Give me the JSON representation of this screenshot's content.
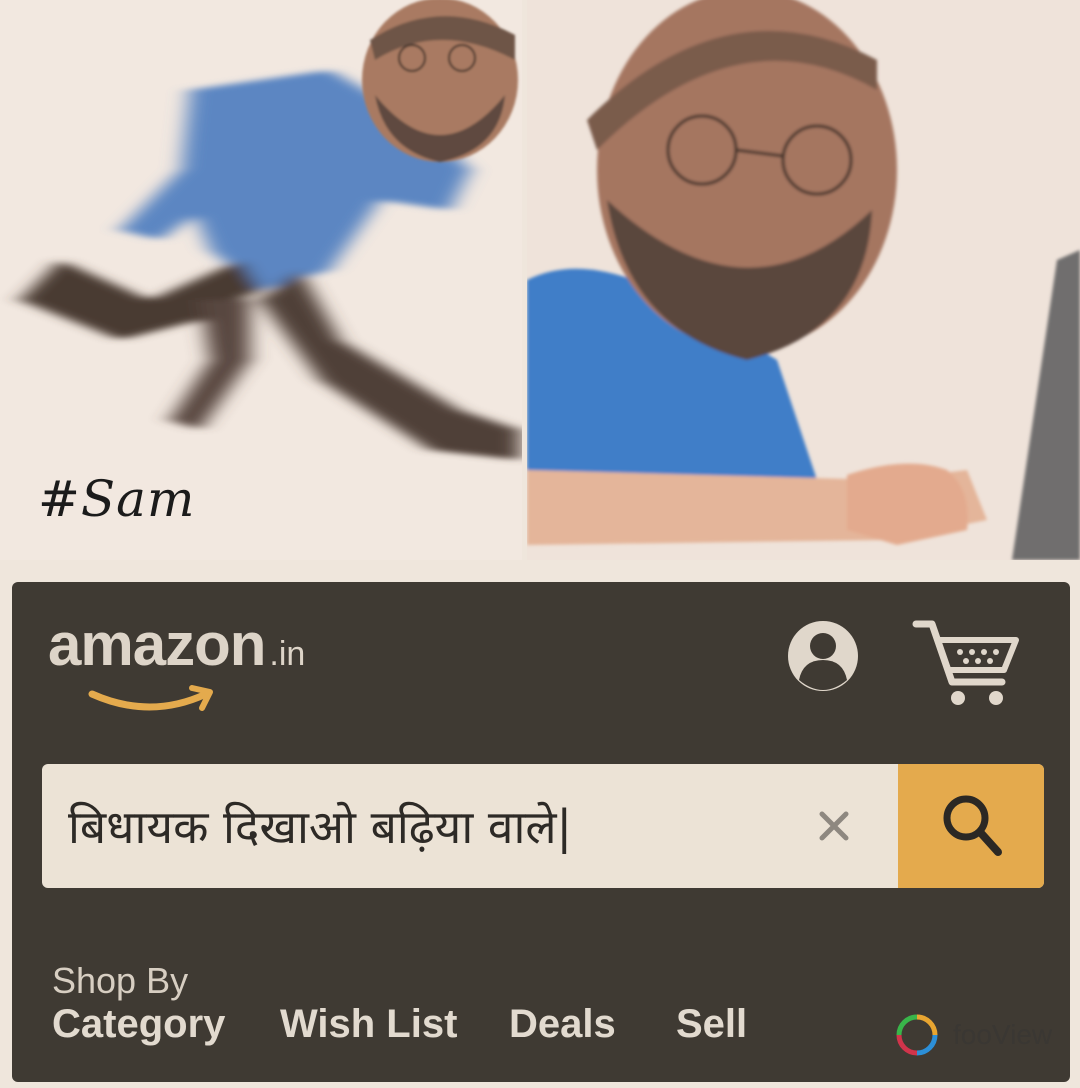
{
  "meme": {
    "hashtag": "#Sam"
  },
  "amazon": {
    "logo_word": "amazon",
    "logo_tld": ".in",
    "account_icon": "account-circle-icon",
    "cart_icon": "cart-icon",
    "search": {
      "value": "बिधायक दिखाओ बढ़िया वाले|",
      "clear_icon": "close-icon",
      "search_icon": "search-icon"
    },
    "shop_by_label": "Shop By",
    "nav": [
      "Category",
      "Wish List",
      "Deals",
      "Sell"
    ],
    "colors": {
      "bar": "#3f3a33",
      "search_button": "#e4aa4d",
      "smile": "#e4aa4d"
    }
  },
  "watermark": {
    "text": "fooView"
  }
}
